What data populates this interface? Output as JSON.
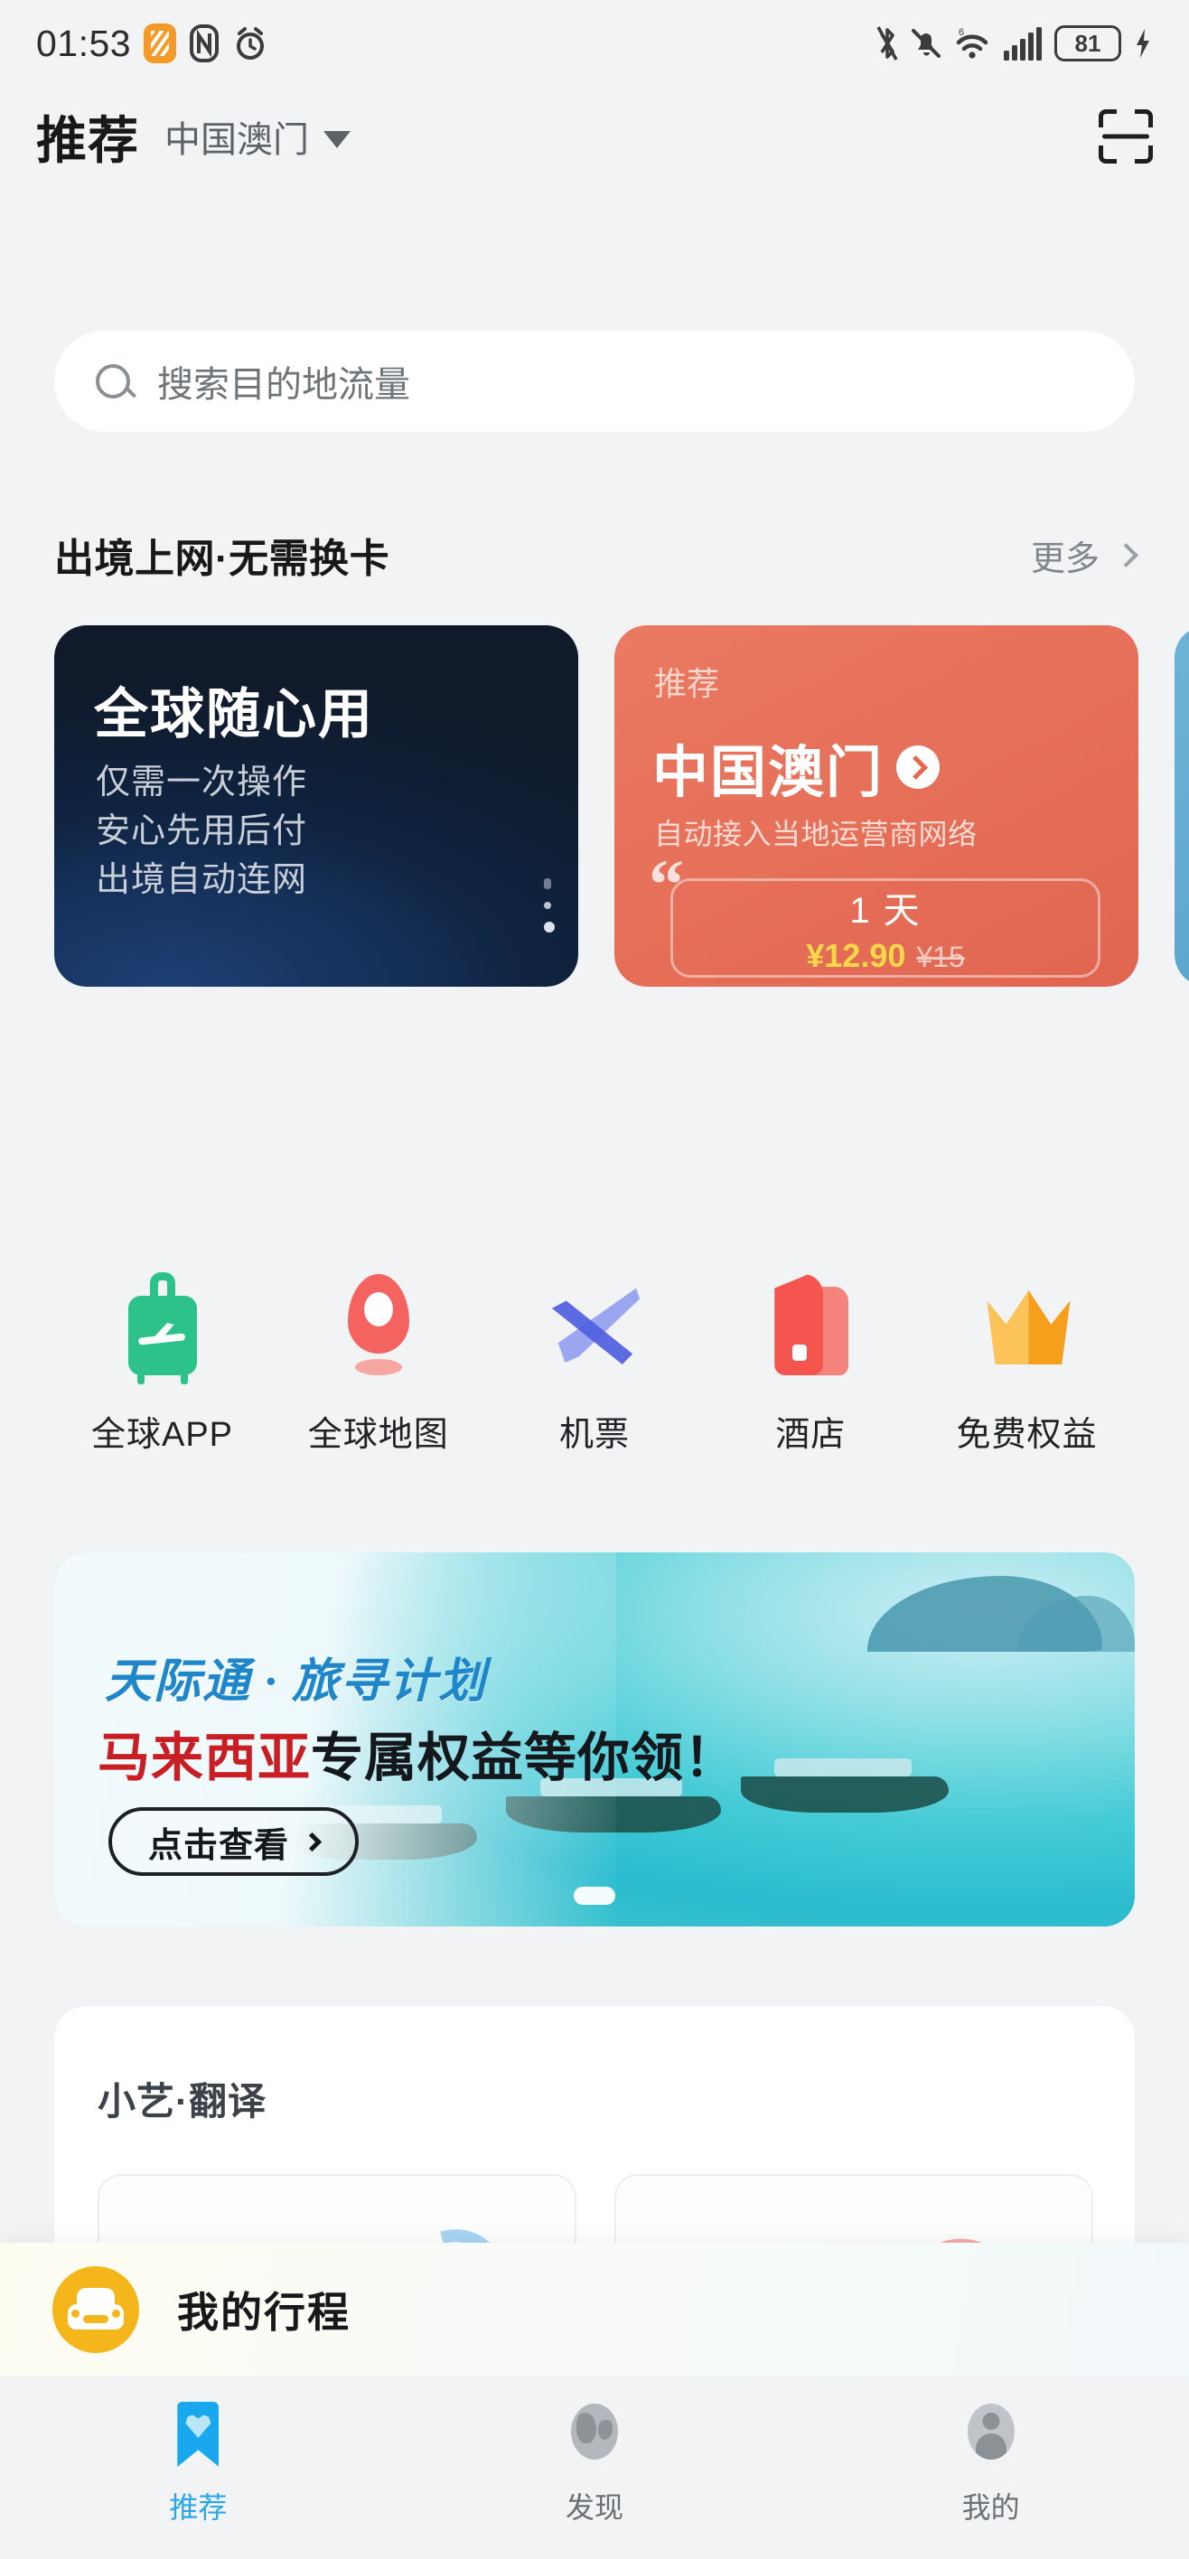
{
  "status_bar": {
    "time": "01:53",
    "left_icons": [
      "app-orange-icon",
      "nfc-icon",
      "alarm-icon"
    ],
    "right_icons": [
      "bluetooth-icon",
      "silent-bell-icon",
      "wifi-6plus-icon",
      "signal-bars-icon"
    ],
    "battery_level": "81",
    "charging": true
  },
  "header": {
    "title": "推荐",
    "city": "中国澳门",
    "scan_icon": "scan-icon"
  },
  "search": {
    "placeholder": "搜索目的地流量",
    "icon": "search-icon"
  },
  "section": {
    "title": "出境上网·无需换卡",
    "more_label": "更多",
    "more_icon": "chevron-right-icon"
  },
  "cards": {
    "dark": {
      "title": "全球随心用",
      "lines": [
        "仅需一次操作",
        "安心先用后付",
        "出境自动连网"
      ]
    },
    "orange": {
      "tag": "推荐",
      "city": "中国澳门",
      "arrow_icon": "arrow-right-circle-icon",
      "subtitle": "自动接入当地运营商网络",
      "quote_icon": "quote-mark-icon",
      "duration": "1 天",
      "price": "¥12.90",
      "original_price": "¥15"
    }
  },
  "quick_actions": [
    {
      "label": "全球APP",
      "icon": "suitcase-icon",
      "color": "#2ec28b"
    },
    {
      "label": "全球地图",
      "icon": "map-pin-icon",
      "color": "#f4635f"
    },
    {
      "label": "机票",
      "icon": "airplane-icon",
      "color": "#4f5fe0"
    },
    {
      "label": "酒店",
      "icon": "hotel-icon",
      "color": "#f4554f"
    },
    {
      "label": "免费权益",
      "icon": "crown-icon",
      "color": "#f59f1c"
    }
  ],
  "banner": {
    "kicker": "天际通 · 旅寻计划",
    "headline_highlight": "马来西亚",
    "headline_rest": "专属权益等你领！",
    "button_label": "点击查看",
    "button_icon": "chevron-right-icon",
    "highlight_color": "#c81e24",
    "kicker_color": "#1f86c9"
  },
  "translate_card": {
    "title": "小艺·翻译"
  },
  "trip_bar": {
    "label": "我的行程",
    "icon": "car-icon",
    "icon_color": "#f5b61b"
  },
  "bottom_nav": {
    "active_color": "#2ba6ec",
    "items": [
      {
        "label": "推荐",
        "icon": "bookmark-heart-icon",
        "active": true
      },
      {
        "label": "发现",
        "icon": "globe-icon",
        "active": false
      },
      {
        "label": "我的",
        "icon": "person-icon",
        "active": false
      }
    ]
  }
}
